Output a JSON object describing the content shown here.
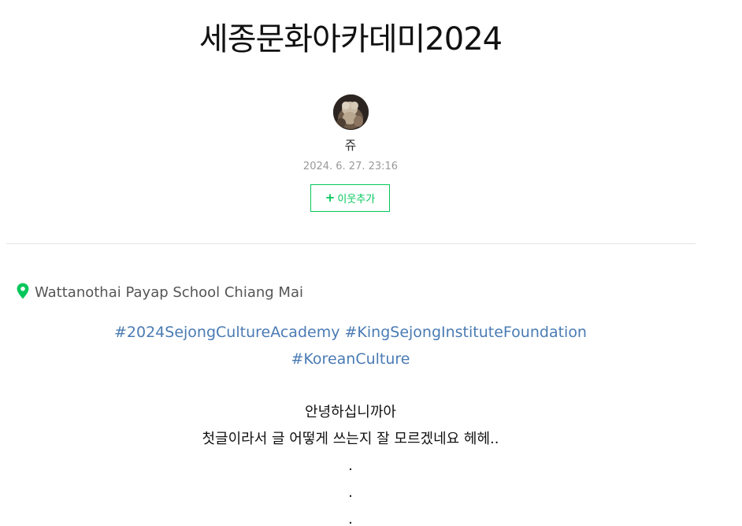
{
  "post": {
    "title": "세종문화아카데미2024",
    "author": {
      "nickname": "쥬",
      "date": "2024. 6. 27. 23:16"
    },
    "neighbor_button": {
      "icon": "+",
      "label": "이웃추가"
    },
    "location": {
      "icon": "map-pin-icon",
      "name": "Wattanothai Payap School Chiang Mai"
    },
    "hashtags": [
      "#2024SejongCultureAcademy",
      "#KingSejongInstituteFoundation",
      "#KoreanCulture"
    ],
    "body": [
      "안녕하십니까아",
      "첫글이라서 글 어떻게 쓰는지 잘 모르겠네요 헤헤..",
      ".",
      ".",
      "."
    ]
  },
  "colors": {
    "accent_green": "#03c75a",
    "hashtag_blue": "#4a7bb4",
    "date_gray": "#999999"
  }
}
